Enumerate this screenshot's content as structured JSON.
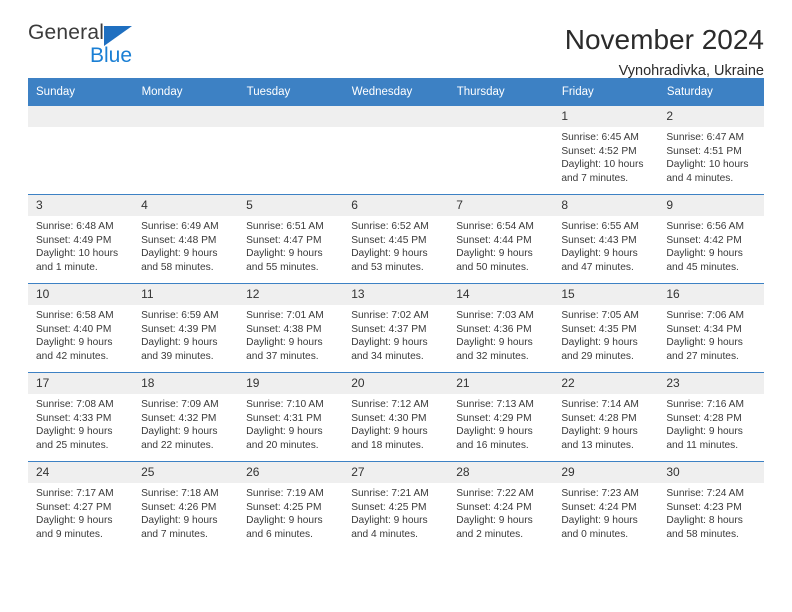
{
  "brand": {
    "name_part1": "General",
    "name_part2": "Blue",
    "accent_color": "#1a7fd4",
    "triangle_color": "#1f6fc0"
  },
  "header": {
    "title": "November 2024",
    "subtitle": "Vynohradivka, Ukraine"
  },
  "theme": {
    "header_bg": "#3d81c4",
    "daynum_bg": "#efefef",
    "text": "#333333"
  },
  "weekday_headers": [
    "Sunday",
    "Monday",
    "Tuesday",
    "Wednesday",
    "Thursday",
    "Friday",
    "Saturday"
  ],
  "labels": {
    "sunrise": "Sunrise:",
    "sunset": "Sunset:",
    "daylight": "Daylight:"
  },
  "weeks": [
    [
      {
        "day": "",
        "empty": true
      },
      {
        "day": "",
        "empty": true
      },
      {
        "day": "",
        "empty": true
      },
      {
        "day": "",
        "empty": true
      },
      {
        "day": "",
        "empty": true
      },
      {
        "day": "1",
        "sunrise": "Sunrise: 6:45 AM",
        "sunset": "Sunset: 4:52 PM",
        "daylight": "Daylight: 10 hours and 7 minutes."
      },
      {
        "day": "2",
        "sunrise": "Sunrise: 6:47 AM",
        "sunset": "Sunset: 4:51 PM",
        "daylight": "Daylight: 10 hours and 4 minutes."
      }
    ],
    [
      {
        "day": "3",
        "sunrise": "Sunrise: 6:48 AM",
        "sunset": "Sunset: 4:49 PM",
        "daylight": "Daylight: 10 hours and 1 minute."
      },
      {
        "day": "4",
        "sunrise": "Sunrise: 6:49 AM",
        "sunset": "Sunset: 4:48 PM",
        "daylight": "Daylight: 9 hours and 58 minutes."
      },
      {
        "day": "5",
        "sunrise": "Sunrise: 6:51 AM",
        "sunset": "Sunset: 4:47 PM",
        "daylight": "Daylight: 9 hours and 55 minutes."
      },
      {
        "day": "6",
        "sunrise": "Sunrise: 6:52 AM",
        "sunset": "Sunset: 4:45 PM",
        "daylight": "Daylight: 9 hours and 53 minutes."
      },
      {
        "day": "7",
        "sunrise": "Sunrise: 6:54 AM",
        "sunset": "Sunset: 4:44 PM",
        "daylight": "Daylight: 9 hours and 50 minutes."
      },
      {
        "day": "8",
        "sunrise": "Sunrise: 6:55 AM",
        "sunset": "Sunset: 4:43 PM",
        "daylight": "Daylight: 9 hours and 47 minutes."
      },
      {
        "day": "9",
        "sunrise": "Sunrise: 6:56 AM",
        "sunset": "Sunset: 4:42 PM",
        "daylight": "Daylight: 9 hours and 45 minutes."
      }
    ],
    [
      {
        "day": "10",
        "sunrise": "Sunrise: 6:58 AM",
        "sunset": "Sunset: 4:40 PM",
        "daylight": "Daylight: 9 hours and 42 minutes."
      },
      {
        "day": "11",
        "sunrise": "Sunrise: 6:59 AM",
        "sunset": "Sunset: 4:39 PM",
        "daylight": "Daylight: 9 hours and 39 minutes."
      },
      {
        "day": "12",
        "sunrise": "Sunrise: 7:01 AM",
        "sunset": "Sunset: 4:38 PM",
        "daylight": "Daylight: 9 hours and 37 minutes."
      },
      {
        "day": "13",
        "sunrise": "Sunrise: 7:02 AM",
        "sunset": "Sunset: 4:37 PM",
        "daylight": "Daylight: 9 hours and 34 minutes."
      },
      {
        "day": "14",
        "sunrise": "Sunrise: 7:03 AM",
        "sunset": "Sunset: 4:36 PM",
        "daylight": "Daylight: 9 hours and 32 minutes."
      },
      {
        "day": "15",
        "sunrise": "Sunrise: 7:05 AM",
        "sunset": "Sunset: 4:35 PM",
        "daylight": "Daylight: 9 hours and 29 minutes."
      },
      {
        "day": "16",
        "sunrise": "Sunrise: 7:06 AM",
        "sunset": "Sunset: 4:34 PM",
        "daylight": "Daylight: 9 hours and 27 minutes."
      }
    ],
    [
      {
        "day": "17",
        "sunrise": "Sunrise: 7:08 AM",
        "sunset": "Sunset: 4:33 PM",
        "daylight": "Daylight: 9 hours and 25 minutes."
      },
      {
        "day": "18",
        "sunrise": "Sunrise: 7:09 AM",
        "sunset": "Sunset: 4:32 PM",
        "daylight": "Daylight: 9 hours and 22 minutes."
      },
      {
        "day": "19",
        "sunrise": "Sunrise: 7:10 AM",
        "sunset": "Sunset: 4:31 PM",
        "daylight": "Daylight: 9 hours and 20 minutes."
      },
      {
        "day": "20",
        "sunrise": "Sunrise: 7:12 AM",
        "sunset": "Sunset: 4:30 PM",
        "daylight": "Daylight: 9 hours and 18 minutes."
      },
      {
        "day": "21",
        "sunrise": "Sunrise: 7:13 AM",
        "sunset": "Sunset: 4:29 PM",
        "daylight": "Daylight: 9 hours and 16 minutes."
      },
      {
        "day": "22",
        "sunrise": "Sunrise: 7:14 AM",
        "sunset": "Sunset: 4:28 PM",
        "daylight": "Daylight: 9 hours and 13 minutes."
      },
      {
        "day": "23",
        "sunrise": "Sunrise: 7:16 AM",
        "sunset": "Sunset: 4:28 PM",
        "daylight": "Daylight: 9 hours and 11 minutes."
      }
    ],
    [
      {
        "day": "24",
        "sunrise": "Sunrise: 7:17 AM",
        "sunset": "Sunset: 4:27 PM",
        "daylight": "Daylight: 9 hours and 9 minutes."
      },
      {
        "day": "25",
        "sunrise": "Sunrise: 7:18 AM",
        "sunset": "Sunset: 4:26 PM",
        "daylight": "Daylight: 9 hours and 7 minutes."
      },
      {
        "day": "26",
        "sunrise": "Sunrise: 7:19 AM",
        "sunset": "Sunset: 4:25 PM",
        "daylight": "Daylight: 9 hours and 6 minutes."
      },
      {
        "day": "27",
        "sunrise": "Sunrise: 7:21 AM",
        "sunset": "Sunset: 4:25 PM",
        "daylight": "Daylight: 9 hours and 4 minutes."
      },
      {
        "day": "28",
        "sunrise": "Sunrise: 7:22 AM",
        "sunset": "Sunset: 4:24 PM",
        "daylight": "Daylight: 9 hours and 2 minutes."
      },
      {
        "day": "29",
        "sunrise": "Sunrise: 7:23 AM",
        "sunset": "Sunset: 4:24 PM",
        "daylight": "Daylight: 9 hours and 0 minutes."
      },
      {
        "day": "30",
        "sunrise": "Sunrise: 7:24 AM",
        "sunset": "Sunset: 4:23 PM",
        "daylight": "Daylight: 8 hours and 58 minutes."
      }
    ]
  ]
}
